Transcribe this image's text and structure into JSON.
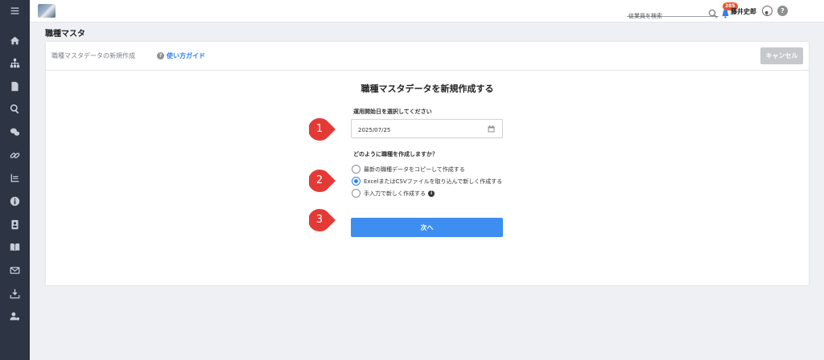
{
  "sidebar": {
    "items": [
      {
        "icon": "menu-icon"
      },
      {
        "icon": "home-icon"
      },
      {
        "icon": "org-chart-icon"
      },
      {
        "icon": "document-icon"
      },
      {
        "icon": "search-icon"
      },
      {
        "icon": "chat-icon"
      },
      {
        "icon": "link-icon"
      },
      {
        "icon": "report-icon"
      },
      {
        "icon": "info-icon"
      },
      {
        "icon": "contact-card-icon"
      },
      {
        "icon": "book-icon"
      },
      {
        "icon": "mail-icon"
      },
      {
        "icon": "download-icon"
      },
      {
        "icon": "user-settings-icon"
      }
    ]
  },
  "header": {
    "search_placeholder": "従業員を検索",
    "notification_count": "285",
    "user_name": "藤井史郎",
    "help_label": "?"
  },
  "page": {
    "title": "職種マスタ"
  },
  "card": {
    "header_title": "職種マスタデータの新規作成",
    "guide_label": "使い方ガイド",
    "cancel_label": "キャンセル"
  },
  "form": {
    "title": "職種マスタデータを新規作成する",
    "date_label": "運用開始日を選択してください",
    "date_value": "2025/07/25",
    "question": "どのように職種を作成しますか？",
    "options": [
      {
        "label": "最新の職種データをコピーして作成する",
        "checked": false
      },
      {
        "label": "ExcelまたはCSVファイルを取り込んで新しく作成する",
        "checked": true
      },
      {
        "label": "手入力で新しく作成する",
        "checked": false
      }
    ],
    "next_label": "次へ"
  },
  "markers": [
    "1",
    "2",
    "3"
  ],
  "colors": {
    "sidebar_bg": "#2d3443",
    "primary": "#3d8ef0",
    "link": "#2f80ed",
    "badge": "#e8532e",
    "marker": "#e53935"
  }
}
